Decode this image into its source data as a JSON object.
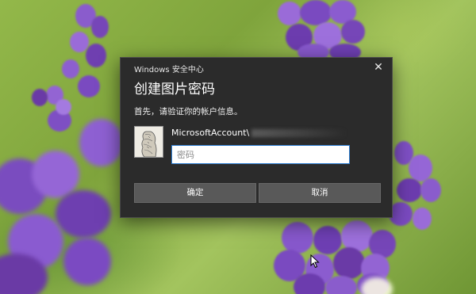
{
  "window": {
    "title": "Windows 安全中心",
    "close_symbol": "✕"
  },
  "dialog": {
    "heading": "创建图片密码",
    "description": "首先，请验证你的帐户信息。",
    "account_label": "MicrosoftAccount\\",
    "password_placeholder": "密码",
    "ok_label": "确定",
    "cancel_label": "取消"
  },
  "colors": {
    "dialog_bg": "#2b2b2b",
    "button_bg": "#595959",
    "input_focus_border": "#2f7fd4",
    "wallpaper_green": "#8fb548",
    "lavender": "#7d4fc2"
  },
  "icons": {
    "close": "close-icon",
    "avatar": "user-avatar",
    "cursor": "mouse-pointer-icon"
  }
}
